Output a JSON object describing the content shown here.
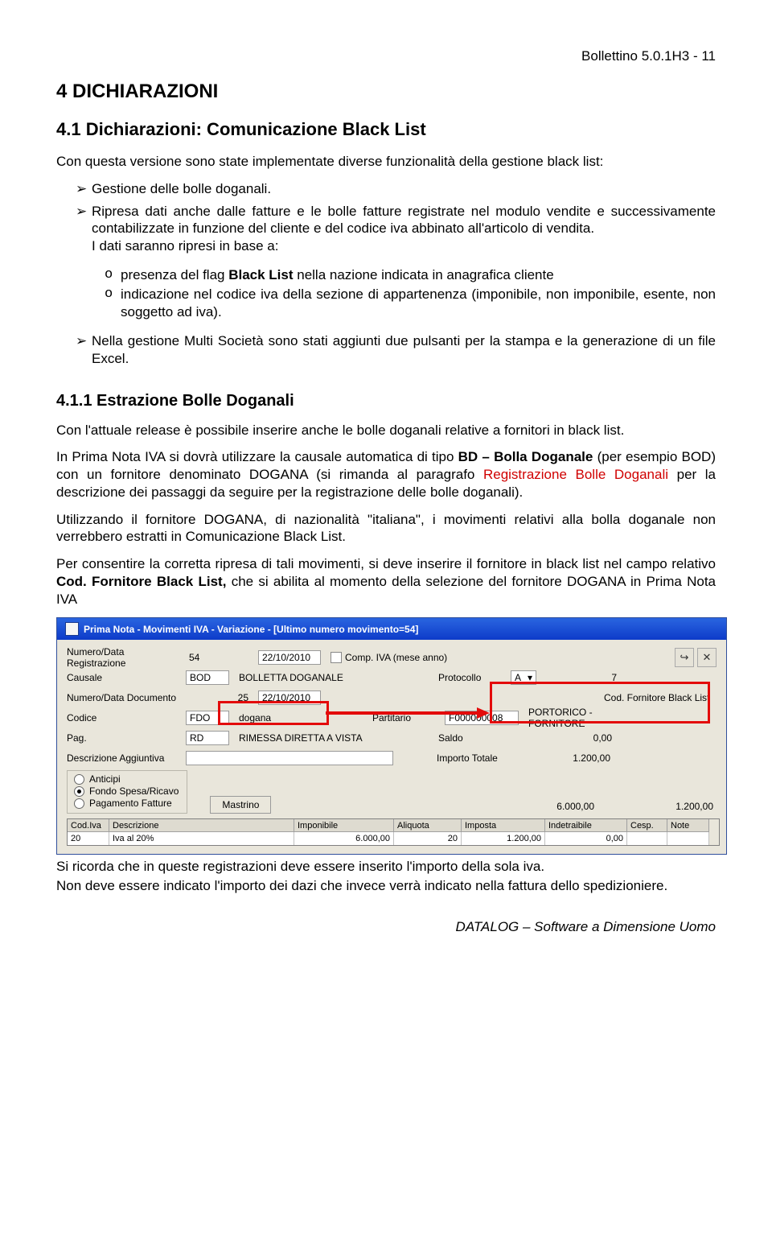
{
  "header": {
    "right": "Bollettino 5.0.1H3 - 11"
  },
  "h1": "4   DICHIARAZIONI",
  "h2": "4.1  Dichiarazioni: Comunicazione Black List",
  "p1": "Con questa versione sono state implementate diverse funzionalità della gestione black list:",
  "bullets1": {
    "b1": "Gestione delle bolle doganali.",
    "b2": "Ripresa dati anche dalle fatture e le bolle fatture registrate nel modulo vendite e successivamente contabilizzate in funzione del cliente e del codice iva abbinato all'articolo di vendita.",
    "b2_tail": "I dati saranno ripresi in base a:"
  },
  "sub1": {
    "s1a": "presenza del flag ",
    "s1b": "Black List",
    "s1c": " nella nazione indicata in anagrafica cliente",
    "s2": "indicazione nel codice iva della sezione di appartenenza (imponibile, non imponibile, esente, non soggetto ad iva)."
  },
  "bullets2": {
    "b3": "Nella gestione Multi Società sono stati aggiunti due pulsanti per la stampa e la generazione di un file Excel."
  },
  "h3": "4.1.1  Estrazione Bolle Doganali",
  "p2": "Con l'attuale release è possibile inserire anche le bolle doganali relative a fornitori in black list.",
  "p3a": "In Prima Nota IVA si dovrà utilizzare la causale automatica di tipo ",
  "p3b": "BD – Bolla Doganale",
  "p3c": " (per esempio BOD) con un fornitore denominato DOGANA (si rimanda al paragrafo ",
  "p3d": "Registrazione Bolle Doganali",
  "p3e": " per la descrizione dei passaggi da seguire per la registrazione delle bolle doganali).",
  "p4": "Utilizzando il fornitore DOGANA, di nazionalità \"italiana\", i movimenti relativi alla bolla doganale non verrebbero estratti in Comunicazione Black List.",
  "p5a": "Per consentire la corretta ripresa di tali movimenti, si deve inserire il fornitore in black list nel campo relativo ",
  "p5b": "Cod. Fornitore Black List,",
  "p5c": " che si abilita al momento della selezione del fornitore DOGANA in Prima Nota IVA",
  "app": {
    "title": "Prima Nota - Movimenti IVA - Variazione - [Ultimo numero movimento=54]",
    "labels": {
      "numdata": "Numero/Data Registrazione",
      "causale": "Causale",
      "numdoc": "Numero/Data Documento",
      "codice": "Codice",
      "pag": "Pag.",
      "descr": "Descrizione Aggiuntiva",
      "comp": "Comp. IVA (mese anno)",
      "prot": "Protocollo",
      "codforn": "Cod. Fornitore Black List",
      "partitario": "Partitario",
      "saldo": "Saldo",
      "importo": "Importo Totale",
      "mastrino": "Mastrino"
    },
    "values": {
      "num": "54",
      "datareg": "22/10/2010",
      "causale_code": "BOD",
      "causale_desc": "BOLLETTA DOGANALE",
      "numdoc": "25",
      "datadoc": "22/10/2010",
      "prot_a": "A",
      "prot_n": "7",
      "cod": "FDO",
      "cod_desc": "dogana",
      "forn_code": "F000000008",
      "forn_desc": "PORTORICO - FORNITORE",
      "pag_code": "RD",
      "pag_desc": "RIMESSA DIRETTA A VISTA",
      "saldo": "0,00",
      "importo": "1.200,00",
      "mast_a": "6.000,00",
      "mast_b": "1.200,00"
    },
    "radios": {
      "r1": "Anticipi",
      "r2": "Fondo Spesa/Ricavo",
      "r3": "Pagamento Fatture"
    },
    "table": {
      "headers": {
        "c1": "Cod.Iva",
        "c2": "Descrizione",
        "c3": "Imponibile",
        "c4": "Aliquota",
        "c5": "Imposta",
        "c6": "Indetraibile",
        "c7": "Cesp.",
        "c8": "Note"
      },
      "row": {
        "c1": "20",
        "c2": "Iva al 20%",
        "c3": "6.000,00",
        "c4": "20",
        "c5": "1.200,00",
        "c6": "0,00"
      }
    }
  },
  "p6": "Si ricorda che in queste registrazioni deve essere inserito l'importo della sola iva.",
  "p7": "Non deve essere indicato l'importo dei dazi che invece verrà indicato nella fattura dello spedizioniere.",
  "footer": "DATALOG – Software a Dimensione Uomo"
}
